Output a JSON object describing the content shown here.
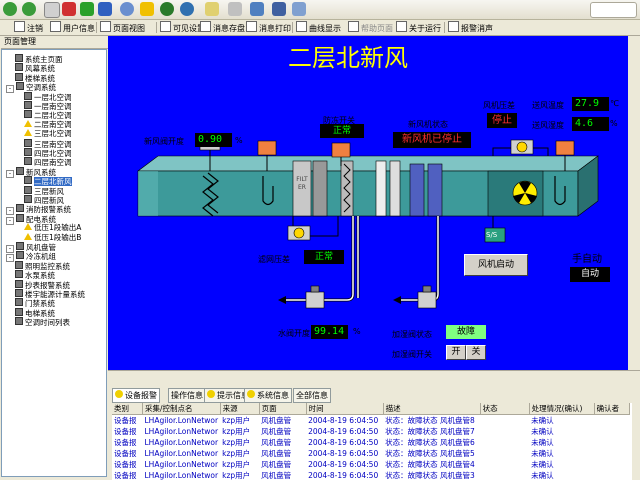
{
  "app_toolbar": {
    "items": [
      "注销",
      "用户信息",
      "页面视图",
      "可见设置",
      "消息存盘",
      "消息打印",
      "曲线显示",
      "帮助页面",
      "关于运行",
      "报警消声"
    ]
  },
  "tree": {
    "title": "页面管理",
    "items": [
      {
        "label": "系统主页面",
        "level": 1,
        "type": "page"
      },
      {
        "label": "风幕系统",
        "level": 1,
        "type": "page"
      },
      {
        "label": "楼梯系统",
        "level": 1,
        "type": "page"
      },
      {
        "label": "空调系统",
        "level": 0,
        "type": "folder"
      },
      {
        "label": "一层北空调",
        "level": 2,
        "type": "page"
      },
      {
        "label": "一层南空调",
        "level": 2,
        "type": "page"
      },
      {
        "label": "二层北空调",
        "level": 2,
        "type": "page"
      },
      {
        "label": "二层南空调",
        "level": 2,
        "type": "warn"
      },
      {
        "label": "三层北空调",
        "level": 2,
        "type": "warn"
      },
      {
        "label": "三层南空调",
        "level": 2,
        "type": "page"
      },
      {
        "label": "四层北空调",
        "level": 2,
        "type": "page"
      },
      {
        "label": "四层南空调",
        "level": 2,
        "type": "page"
      },
      {
        "label": "新风系统",
        "level": 0,
        "type": "folder"
      },
      {
        "label": "二层北新风",
        "level": 2,
        "type": "page",
        "selected": true
      },
      {
        "label": "三层新风",
        "level": 2,
        "type": "page"
      },
      {
        "label": "四层新风",
        "level": 2,
        "type": "page"
      },
      {
        "label": "消防报警系统",
        "level": 0,
        "type": "folder"
      },
      {
        "label": "配电系统",
        "level": 0,
        "type": "folder"
      },
      {
        "label": "低压1段输出A",
        "level": 2,
        "type": "warn"
      },
      {
        "label": "低压1段输出B",
        "level": 2,
        "type": "warn"
      },
      {
        "label": "风机盘管",
        "level": 0,
        "type": "folder"
      },
      {
        "label": "冷冻机组",
        "level": 0,
        "type": "folder"
      },
      {
        "label": "照明监控系统",
        "level": 1,
        "type": "page"
      },
      {
        "label": "水泵系统",
        "level": 1,
        "type": "page"
      },
      {
        "label": "抄表报警系统",
        "level": 1,
        "type": "page"
      },
      {
        "label": "楼宇能源计量系统",
        "level": 1,
        "type": "page"
      },
      {
        "label": "门禁系统",
        "level": 1,
        "type": "page"
      },
      {
        "label": "电梯系统",
        "level": 1,
        "type": "page"
      },
      {
        "label": "空调时间列表",
        "level": 1,
        "type": "page"
      }
    ]
  },
  "hmi": {
    "title": "二层北新风",
    "fresh_air_valve_label": "新风阀开度",
    "fresh_air_valve_value": "0.90",
    "percent": "%",
    "frost_switch_label": "防冻开关",
    "frost_switch_value": "正常",
    "fan_status_label": "新风机状态",
    "fan_status_value": "新风机已停止",
    "fan_pressure_label": "风机压差",
    "fan_pressure_value": "停止",
    "supply_temp_label": "送风温度",
    "supply_temp_value": "27.9",
    "temp_unit": "℃",
    "supply_hum_label": "送风湿度",
    "supply_hum_value": "4.6",
    "filter_text": "FILTER",
    "filter_pressure_label": "滤网压差",
    "filter_pressure_value": "正常",
    "fan_start_button": "风机启动",
    "mode_label": "手自动",
    "mode_value": "自动",
    "water_valve_label": "水阀开度",
    "water_valve_value": "99.14",
    "humidifier_status_label": "加湿阀状态",
    "humidifier_status_value": "故障",
    "humidifier_switch_label": "加湿阀开关",
    "humidifier_on": "开",
    "humidifier_off": "关",
    "ss_label": "S/S",
    "colors": {
      "panel": "#0000ff",
      "duct": "#3d9a9a",
      "display_green": "#00ff00",
      "display_red": "#ff3030",
      "fault_bg": "#80ff80"
    }
  },
  "alarm_tabs": [
    "设备报警",
    "操作信息",
    "提示信息",
    "系统信息",
    "全部信息"
  ],
  "alarm_table": {
    "columns": [
      "类别",
      "采集/控制点名",
      "来源",
      "页面",
      "时间",
      "描述",
      "状态",
      "处理情况(确认)",
      "确认者"
    ],
    "rows": [
      [
        "设备报",
        "LHAgilor.LonNetwor",
        "kzp用户",
        "风机盘管",
        "2004-8-19 6:04:50",
        "状态：故障状态 风机盘管8",
        "",
        "未确认",
        ""
      ],
      [
        "设备报",
        "LHAgilor.LonNetwor",
        "kzp用户",
        "风机盘管",
        "2004-8-19 6:04:50",
        "状态：故障状态 风机盘管7",
        "",
        "未确认",
        ""
      ],
      [
        "设备报",
        "LHAgilor.LonNetwor",
        "kzp用户",
        "风机盘管",
        "2004-8-19 6:04:50",
        "状态：故障状态 风机盘管6",
        "",
        "未确认",
        ""
      ],
      [
        "设备报",
        "LHAgilor.LonNetwor",
        "kzp用户",
        "风机盘管",
        "2004-8-19 6:04:50",
        "状态：故障状态 风机盘管5",
        "",
        "未确认",
        ""
      ],
      [
        "设备报",
        "LHAgilor.LonNetwor",
        "kzp用户",
        "风机盘管",
        "2004-8-19 6:04:50",
        "状态：故障状态 风机盘管4",
        "",
        "未确认",
        ""
      ],
      [
        "设备报",
        "LHAgilor.LonNetwor",
        "kzp用户",
        "风机盘管",
        "2004-8-19 6:04:50",
        "状态：故障状态 风机盘管3",
        "",
        "未确认",
        ""
      ]
    ]
  }
}
